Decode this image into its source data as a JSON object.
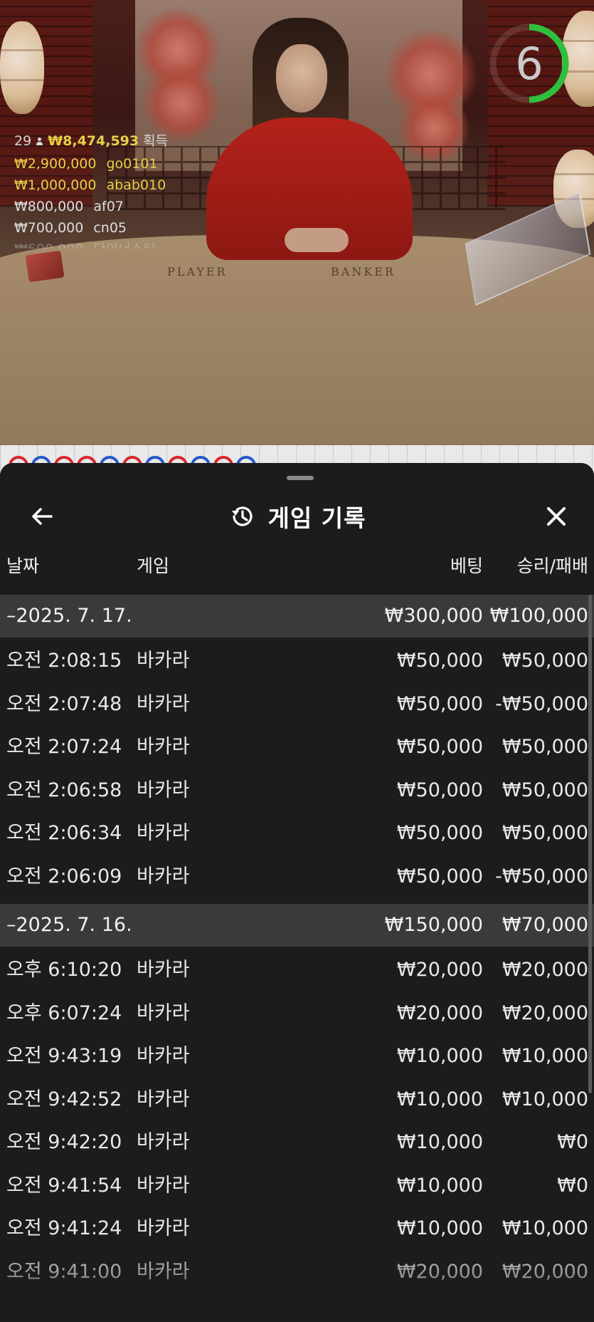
{
  "video": {
    "timer": "6",
    "table_labels": {
      "player": "PLAYER",
      "banker": "BANKER"
    },
    "winners": {
      "count": "29",
      "total": "₩8,474,593",
      "label": "획득",
      "rows": [
        {
          "amount": "₩2,900,000",
          "name": "go0101"
        },
        {
          "amount": "₩1,000,000",
          "name": "abab010"
        },
        {
          "amount": "₩800,000",
          "name": "af07"
        },
        {
          "amount": "₩700,000",
          "name": "cn05"
        },
        {
          "amount": "₩600,000",
          "name": "다이너스티"
        }
      ]
    },
    "road_beads": [
      "red",
      "blue",
      "red",
      "red",
      "blue",
      "red",
      "blue",
      "red",
      "blue",
      "red",
      "blue"
    ]
  },
  "panel": {
    "title": "게임 기록",
    "icons": {
      "back": "arrow-left-icon",
      "history": "history-icon",
      "close": "close-icon"
    },
    "columns": {
      "date": "날짜",
      "game": "게임",
      "bet": "베팅",
      "result": "승리/패배"
    },
    "groups": [
      {
        "date": "2025. 7. 17.",
        "bet_total": "₩300,000",
        "result_total": "₩100,000",
        "entries": [
          {
            "time": "오전 2:08:15",
            "game": "바카라",
            "bet": "₩50,000",
            "result": "₩50,000"
          },
          {
            "time": "오전 2:07:48",
            "game": "바카라",
            "bet": "₩50,000",
            "result": "-₩50,000"
          },
          {
            "time": "오전 2:07:24",
            "game": "바카라",
            "bet": "₩50,000",
            "result": "₩50,000"
          },
          {
            "time": "오전 2:06:58",
            "game": "바카라",
            "bet": "₩50,000",
            "result": "₩50,000"
          },
          {
            "time": "오전 2:06:34",
            "game": "바카라",
            "bet": "₩50,000",
            "result": "₩50,000"
          },
          {
            "time": "오전 2:06:09",
            "game": "바카라",
            "bet": "₩50,000",
            "result": "-₩50,000"
          }
        ]
      },
      {
        "date": "2025. 7. 16.",
        "bet_total": "₩150,000",
        "result_total": "₩70,000",
        "entries": [
          {
            "time": "오후 6:10:20",
            "game": "바카라",
            "bet": "₩20,000",
            "result": "₩20,000"
          },
          {
            "time": "오후 6:07:24",
            "game": "바카라",
            "bet": "₩20,000",
            "result": "₩20,000"
          },
          {
            "time": "오전 9:43:19",
            "game": "바카라",
            "bet": "₩10,000",
            "result": "₩10,000"
          },
          {
            "time": "오전 9:42:52",
            "game": "바카라",
            "bet": "₩10,000",
            "result": "₩10,000"
          },
          {
            "time": "오전 9:42:20",
            "game": "바카라",
            "bet": "₩10,000",
            "result": "₩0"
          },
          {
            "time": "오전 9:41:54",
            "game": "바카라",
            "bet": "₩10,000",
            "result": "₩0"
          },
          {
            "time": "오전 9:41:24",
            "game": "바카라",
            "bet": "₩10,000",
            "result": "₩10,000"
          },
          {
            "time": "오전 9:41:00",
            "game": "바카라",
            "bet": "₩20,000",
            "result": "₩20,000"
          }
        ]
      }
    ]
  }
}
